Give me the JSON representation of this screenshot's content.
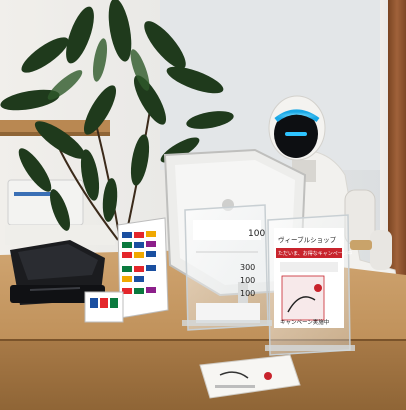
{
  "scene": {
    "description_free": true,
    "colors": {
      "wall": "#e9e6e1",
      "glass_wall": "#dfe3e6",
      "wood_panel": "#9a5a2e",
      "desk_top": "#c79a63",
      "desk_front": "#b98a55",
      "robot_shell": "#f2f1ee",
      "robot_face": "#0d0f12",
      "robot_glow": "#2ec4ff",
      "plant_leaf": "#1f3a1c",
      "terminal": "#1b1c1f",
      "sign_accent": "#c8232c"
    }
  },
  "signs": {
    "center_price": "100",
    "price_1": "300",
    "price_2": "100",
    "price_3": "100",
    "right_title": "ヴィーブルショップ",
    "right_banner": "ただいま、お得なキャンペーン中",
    "right_sub": "キャンペーン実施中"
  },
  "icons": {
    "plant": "potted-plant",
    "robot": "service-robot",
    "terminal": "payment-terminal",
    "tablet": "tablet-on-stand",
    "card_stand": "payment-methods-card",
    "flyer": "flyer-on-desk"
  }
}
